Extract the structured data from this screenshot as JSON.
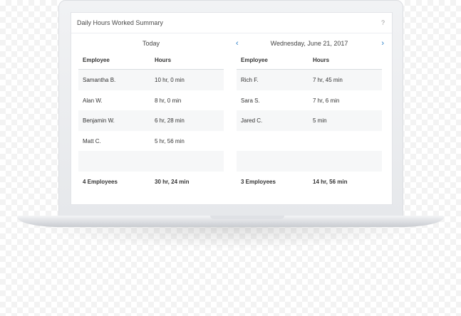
{
  "widget": {
    "title": "Daily Hours Worked Summary",
    "help_label": "?"
  },
  "left_panel": {
    "date_label": "Today",
    "col_employee": "Employee",
    "col_hours": "Hours",
    "rows": [
      {
        "name": "Samantha B.",
        "hours": "10 hr, 0 min"
      },
      {
        "name": "Alan W.",
        "hours": "8 hr, 0 min"
      },
      {
        "name": "Benjamin W.",
        "hours": "6 hr, 28 min"
      },
      {
        "name": "Matt C.",
        "hours": "5 hr, 56 min"
      }
    ],
    "total_employees": "4 Employees",
    "total_hours": "30 hr, 24 min"
  },
  "right_panel": {
    "date_label": "Wednesday, June 21, 2017",
    "prev_icon": "‹",
    "next_icon": "›",
    "col_employee": "Employee",
    "col_hours": "Hours",
    "rows": [
      {
        "name": "Rich F.",
        "hours": "7 hr, 45 min"
      },
      {
        "name": "Sara S.",
        "hours": "7 hr, 6 min"
      },
      {
        "name": "Jared C.",
        "hours": "5 min"
      }
    ],
    "total_employees": "3 Employees",
    "total_hours": "14 hr, 56 min"
  },
  "colors": {
    "accent": "#2a7fc8",
    "row_shade": "#f6f7f8"
  }
}
